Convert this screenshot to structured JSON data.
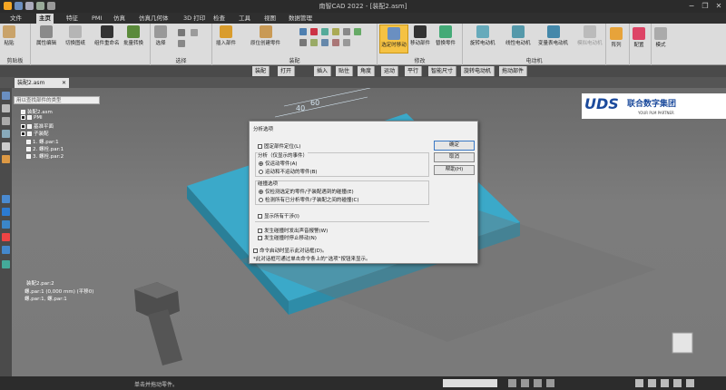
{
  "window": {
    "title": "南智CAD 2022 - [装配2.asm]",
    "controls": [
      "−",
      "❐",
      "✕"
    ]
  },
  "menu": {
    "tabs": [
      "文件",
      "主页",
      "特征",
      "PMI",
      "仿真",
      "仿真几何体",
      "3D 打印",
      "检查",
      "工具",
      "视图",
      "数据管理"
    ],
    "active": 1
  },
  "ribbon": {
    "clipboard": {
      "paste": "粘贴",
      "label": "剪贴板"
    },
    "file_ops": {
      "items": [
        "属性编辑",
        "切换图纸",
        "组件重命名",
        "批量转换"
      ]
    },
    "select": {
      "select": "选择",
      "label": "选择"
    },
    "assemble": {
      "insert": "插入部件",
      "capture": "原位创建零件",
      "label": "装配"
    },
    "modify": {
      "drag": "选定时移动",
      "move": "移动部件",
      "replace": "替换零件",
      "label": "修改"
    },
    "motor": {
      "rotary": "旋转电动机",
      "linear": "线性电动机",
      "variable": "变量表电动机",
      "simulate": "模拟电动机",
      "label": "电动机"
    },
    "pattern": {
      "label": "阵列"
    },
    "config": {
      "label": "配置"
    },
    "mode": {
      "label": "模式"
    }
  },
  "toolbar2": [
    "装配",
    "打开",
    "插入",
    "贴住",
    "角度",
    "运动",
    "平行",
    "智能尺寸",
    "旋转电动机",
    "拖动部件"
  ],
  "document_tab": "装配2.asm",
  "tree": {
    "filter_placeholder": "用以查找部件的类型",
    "root": "装配2.asm",
    "items": [
      "PMI",
      "基准平面",
      "子装配",
      "1. 螺.par:1",
      "2. 螺栓.par:1",
      "3. 螺栓.par:2"
    ]
  },
  "lower_tree": {
    "header": "装配2.par:2",
    "rows": [
      "螺.par:1   (0,000 mm)   (平移0)",
      "螺.par:1, 螺.par:1"
    ]
  },
  "dimensions": [
    "40",
    "60"
  ],
  "logo": {
    "name": "UDS",
    "company": "联合数字集团",
    "tagline": "YOUR PLM PARTNER"
  },
  "dialog": {
    "title": "分析选项",
    "fixed_position": "固定部件定位(L)",
    "analysis_group": "分析（仅显示的事件）",
    "radio_only_active": "仅运动零件(A)",
    "radio_active_and_fixed": "运动和不运动的零件(B)",
    "collision_group": "碰撞选项",
    "radio_check_selected": "仅检测选定的零件/子装配遇到的碰撞(E)",
    "radio_check_all": "检测所有已分析零件/子装配之间的碰撞(C)",
    "show_interference": "显示所有干涉(I)",
    "beep_on_collision": "发生碰撞时发出声音报警(W)",
    "stop_on_collision": "发生碰撞时停止移动(N)",
    "show_on_start": "命令启动时显示此对话框(D)。",
    "note": "*此对话框可通过单击命令条上的“选项”按钮来显示。",
    "ok": "确定",
    "cancel": "取消",
    "help": "帮助(H)"
  },
  "status": {
    "text": "单击并拖动零件。"
  },
  "colors": {
    "plate": "#3ba9c9",
    "dialog_bg": "#f0f0f0",
    "highlight": "#f5c243"
  }
}
